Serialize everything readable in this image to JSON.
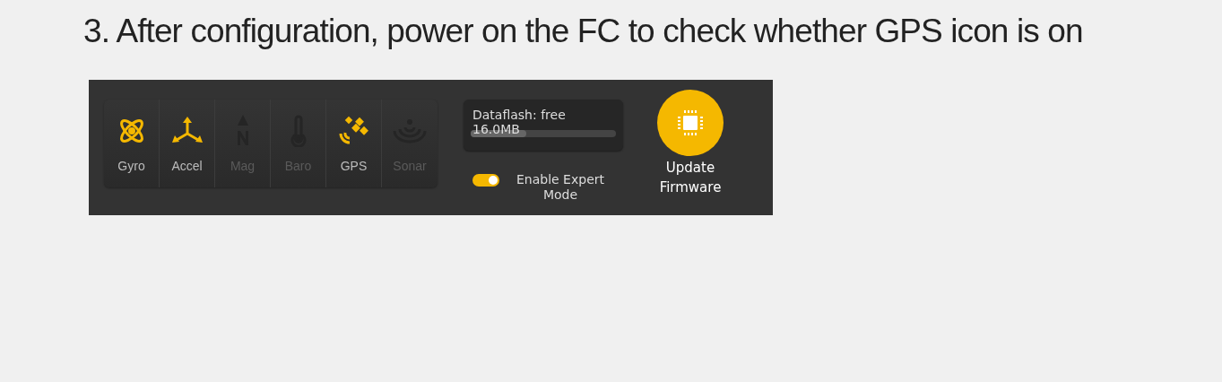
{
  "heading": "3. After configuration, power on the FC to check whether GPS icon is on",
  "sensors": [
    {
      "kind": "gyro",
      "label": "Gyro",
      "on": true
    },
    {
      "kind": "accel",
      "label": "Accel",
      "on": true
    },
    {
      "kind": "mag",
      "label": "Mag",
      "on": false
    },
    {
      "kind": "baro",
      "label": "Baro",
      "on": false
    },
    {
      "kind": "gps",
      "label": "GPS",
      "on": true
    },
    {
      "kind": "sonar",
      "label": "Sonar",
      "on": false
    }
  ],
  "dataflash": {
    "line_1": "Dataflash: free",
    "line_2": "16.0MB",
    "level": 0.38
  },
  "expert_mode": {
    "label": "Enable Expert Mode",
    "on": true
  },
  "update_button": {
    "label": "Update Firmware"
  }
}
